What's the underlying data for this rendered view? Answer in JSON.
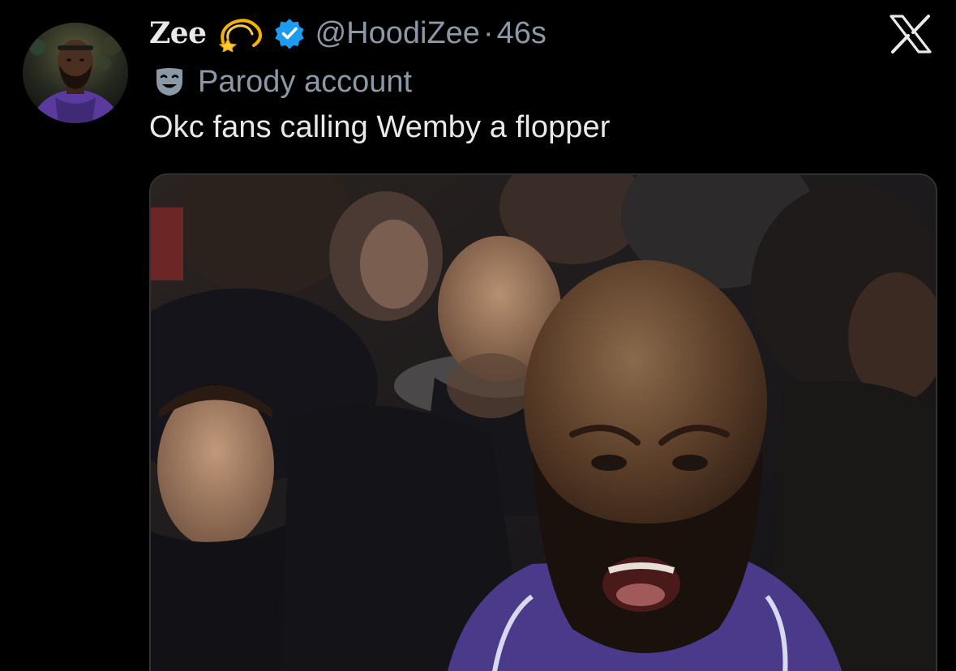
{
  "tweet": {
    "display_name": "Zee",
    "handle": "@HoodiZee",
    "separator": "·",
    "timestamp": "46s",
    "parody_label": "Parody account",
    "text": "Okc fans calling Wemby a flopper",
    "icons": {
      "name_emoji": "dizzy-icon",
      "verified": "verified-badge-icon",
      "parody": "theater-mask-icon",
      "brand": "x-logo-icon"
    },
    "colors": {
      "background": "#000000",
      "primary_text": "#e7e9ea",
      "secondary_text": "#8b98a5",
      "verified_blue": "#1d9bf0"
    }
  }
}
